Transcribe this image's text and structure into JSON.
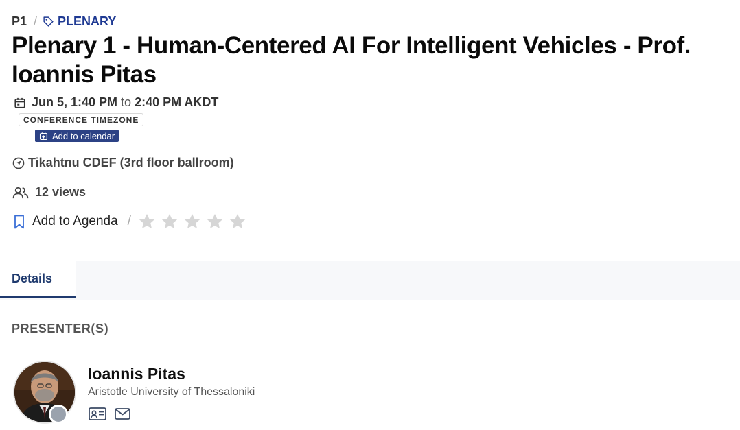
{
  "breadcrumb": {
    "code": "P1",
    "separator": "/",
    "tag": "PLENARY"
  },
  "session": {
    "title": "Plenary 1 - Human-Centered AI For Intelligent Vehicles - Prof. Ioannis Pitas",
    "start": "Jun 5, 1:40 PM",
    "to": "to",
    "end": "2:40 PM AKDT",
    "timezone_badge": "CONFERENCE TIMEZONE",
    "add_to_calendar": "Add to calendar",
    "location": "Tikahtnu CDEF (3rd floor ballroom)",
    "views": "12 views"
  },
  "actions": {
    "add_to_agenda": "Add to Agenda",
    "separator": "/",
    "rating": {
      "value": 0,
      "max": 5
    }
  },
  "tabs": [
    {
      "label": "Details",
      "active": true
    }
  ],
  "presenters": {
    "heading": "PRESENTER(S)",
    "items": [
      {
        "name": "Ioannis Pitas",
        "affiliation": "Aristotle University of Thessaloniki",
        "status": "offline"
      }
    ]
  },
  "colors": {
    "brand": "#1f3a93",
    "tab_active": "#1f3a6e",
    "calendar_button": "#2c4285",
    "star_inactive": "#d6d6d6",
    "status_dot": "#9aa2ad"
  },
  "icons": {
    "tag": "tag-icon",
    "calendar": "calendar-icon",
    "calendar_plus": "calendar-plus-icon",
    "location": "navigation-arrow-icon",
    "views": "users-icon",
    "agenda": "bookmark-icon",
    "star": "star-icon",
    "contact_card": "id-card-icon",
    "email": "envelope-icon"
  }
}
